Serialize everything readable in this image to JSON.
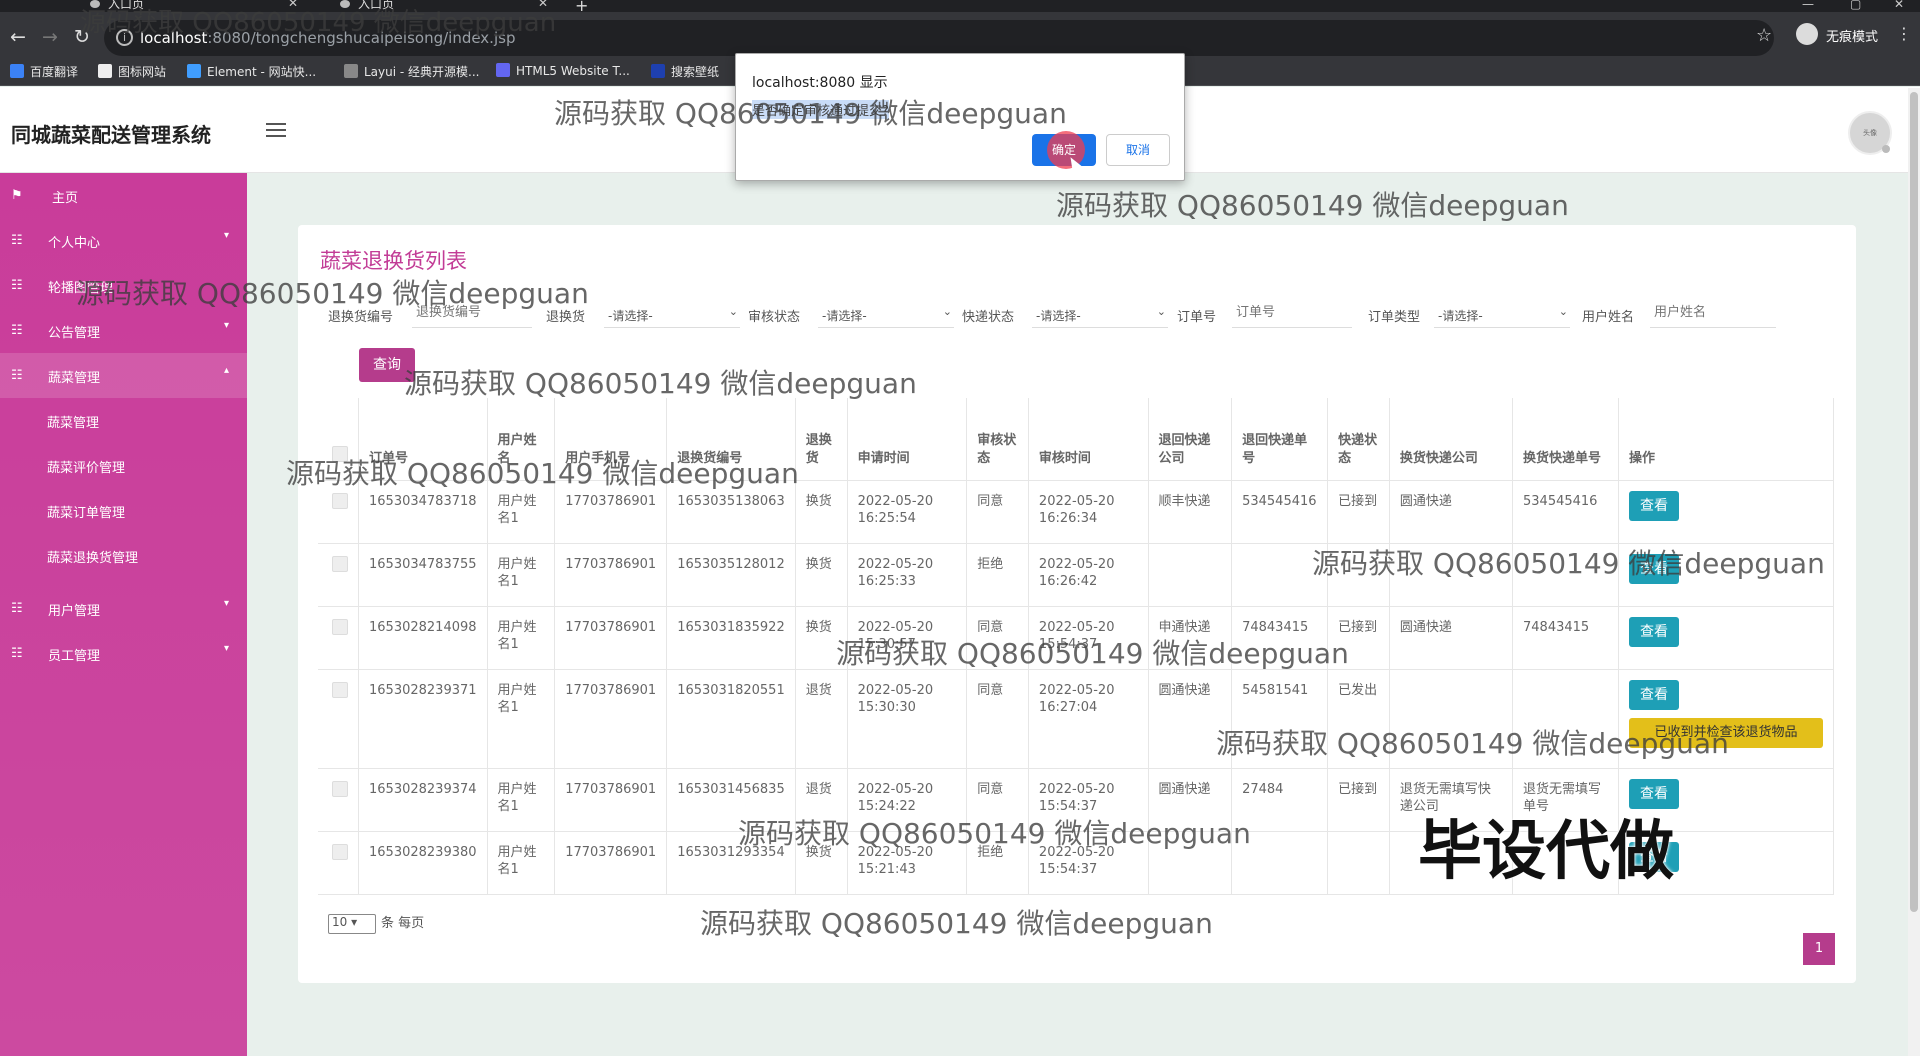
{
  "browser": {
    "tabs": [
      {
        "label": "入口页"
      },
      {
        "label": "入口页"
      }
    ],
    "url_host": "localhost",
    "url_path": ":8080/tongchengshucaipeisong/index.jsp",
    "incognito_label": "无痕模式",
    "bookmarks": [
      "百度翻译",
      "图标网站",
      "Element - 网站快...",
      "Layui - 经典开源模...",
      "HTML5 Website T...",
      "搜索壁纸"
    ]
  },
  "dialog": {
    "title": "localhost:8080 显示",
    "message": "是否确定审核通过提交?",
    "ok_label": "确定",
    "cancel_label": "取消"
  },
  "header": {
    "app_title": "同城蔬菜配送管理系统",
    "avatar_text": "头像"
  },
  "sidebar": {
    "items": [
      {
        "label": "主页",
        "icon": "flag-icon"
      },
      {
        "label": "个人中心",
        "icon": "grid-icon"
      },
      {
        "label": "轮播图管理",
        "icon": "grid-icon"
      },
      {
        "label": "公告管理",
        "icon": "grid-icon"
      },
      {
        "label": "蔬菜管理",
        "icon": "grid-icon"
      },
      {
        "label": "用户管理",
        "icon": "grid-icon"
      },
      {
        "label": "员工管理",
        "icon": "grid-icon"
      }
    ],
    "sub_items": [
      "蔬菜管理",
      "蔬菜评价管理",
      "蔬菜订单管理",
      "蔬菜退换货管理"
    ]
  },
  "page": {
    "title": "蔬菜退换货列表",
    "filters": {
      "return_no_label": "退换货编号",
      "return_no_placeholder": "退换货编号",
      "type_label": "退换货",
      "select_placeholder": "-请选择-",
      "audit_label": "审核状态",
      "express_label": "快递状态",
      "order_no_label": "订单号",
      "order_no_placeholder": "订单号",
      "order_type_label": "订单类型",
      "user_label": "用户姓名",
      "user_placeholder": "用户姓名"
    },
    "query_label": "查询",
    "columns": [
      "订单号",
      "用户姓名",
      "用户手机号",
      "退换货编号",
      "退换货",
      "申请时间",
      "审核状态",
      "审核时间",
      "退回快递公司",
      "退回快递单号",
      "快递状态",
      "换货快递公司",
      "换货快递单号",
      "操作"
    ],
    "rows": [
      {
        "order": "1653034783718",
        "user": "用户姓名1",
        "phone": "17703786901",
        "rno": "1653035138063",
        "type": "换货",
        "apply": "2022-05-20 16:25:54",
        "audit": "同意",
        "audit_time": "2022-05-20 16:26:34",
        "back_co": "顺丰快递",
        "back_no": "534545416",
        "exp": "已接到",
        "ex_co": "圆通快递",
        "ex_no": "534545416",
        "action": "查看",
        "extra": ""
      },
      {
        "order": "1653034783755",
        "user": "用户姓名1",
        "phone": "17703786901",
        "rno": "1653035128012",
        "type": "换货",
        "apply": "2022-05-20 16:25:33",
        "audit": "拒绝",
        "audit_time": "2022-05-20 16:26:42",
        "back_co": "",
        "back_no": "",
        "exp": "",
        "ex_co": "",
        "ex_no": "",
        "action": "查看",
        "extra": ""
      },
      {
        "order": "1653028214098",
        "user": "用户姓名1",
        "phone": "17703786901",
        "rno": "1653031835922",
        "type": "换货",
        "apply": "2022-05-20 15:30:57",
        "audit": "同意",
        "audit_time": "2022-05-20 15:54:37",
        "back_co": "申通快递",
        "back_no": "74843415",
        "exp": "已接到",
        "ex_co": "圆通快递",
        "ex_no": "74843415",
        "action": "查看",
        "extra": ""
      },
      {
        "order": "1653028239371",
        "user": "用户姓名1",
        "phone": "17703786901",
        "rno": "1653031820551",
        "type": "退货",
        "apply": "2022-05-20 15:30:30",
        "audit": "同意",
        "audit_time": "2022-05-20 16:27:04",
        "back_co": "圆通快递",
        "back_no": "54581541",
        "exp": "已发出",
        "ex_co": "",
        "ex_no": "",
        "action": "查看",
        "extra": "已收到并检查该退货物品"
      },
      {
        "order": "1653028239374",
        "user": "用户姓名1",
        "phone": "17703786901",
        "rno": "1653031456835",
        "type": "退货",
        "apply": "2022-05-20 15:24:22",
        "audit": "同意",
        "audit_time": "2022-05-20 15:54:37",
        "back_co": "圆通快递",
        "back_no": "27484",
        "exp": "已接到",
        "ex_co": "退货无需填写快递公司",
        "ex_no": "退货无需填写单号",
        "action": "查看",
        "extra": ""
      },
      {
        "order": "1653028239380",
        "user": "用户姓名1",
        "phone": "17703786901",
        "rno": "1653031293354",
        "type": "换货",
        "apply": "2022-05-20 15:21:43",
        "audit": "拒绝",
        "audit_time": "2022-05-20 15:54:37",
        "back_co": "",
        "back_no": "",
        "exp": "",
        "ex_co": "",
        "ex_no": "",
        "action": "查看",
        "extra": ""
      }
    ],
    "page_size": "10",
    "page_size_suffix": "条 每页",
    "current_page": "1"
  },
  "overlay": {
    "watermark": "源码获取 QQ86050149 微信deepguan",
    "stamp": "毕设代做"
  },
  "colors": {
    "sidebar": "#c93c9a",
    "primary": "#b53c8c",
    "view_button": "#1e9fb6",
    "warn_button": "#e3bf1a"
  }
}
